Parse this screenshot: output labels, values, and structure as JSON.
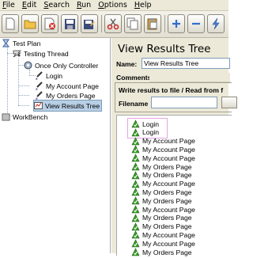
{
  "menu": [
    {
      "label": "File"
    },
    {
      "label": "Edit"
    },
    {
      "label": "Search"
    },
    {
      "label": "Run"
    },
    {
      "label": "Options"
    },
    {
      "label": "Help"
    }
  ],
  "toolbar": {
    "buttons": [
      "new-icon",
      "open-icon",
      "close-icon",
      "save-icon",
      "save-as-icon",
      "cut-icon",
      "copy-icon",
      "paste-icon",
      "expand-icon",
      "collapse-icon",
      "toggle-icon"
    ]
  },
  "tree": {
    "nodes": [
      {
        "label": "Test Plan",
        "icon": "test-plan-icon"
      },
      {
        "label": "Testing Thread",
        "icon": "thread-group-icon"
      },
      {
        "label": "Once Only Controller",
        "icon": "controller-icon"
      },
      {
        "label": "Login",
        "icon": "sampler-icon"
      },
      {
        "label": "My Account Page",
        "icon": "sampler-icon"
      },
      {
        "label": "My Orders Page",
        "icon": "sampler-icon"
      },
      {
        "label": "View Results Tree",
        "icon": "listener-icon"
      },
      {
        "label": "WorkBench",
        "icon": "workbench-icon"
      }
    ]
  },
  "panel": {
    "title": "View Results Tree",
    "name_label": "Name:",
    "name_value": "View Results Tree",
    "comments_label": "Comments:",
    "file_title": "Write results to file / Read from f",
    "filename_label": "Filename"
  },
  "results": [
    "Login",
    "Login",
    "My Account Page",
    "My Account Page",
    "My Account Page",
    "My Orders Page",
    "My Orders Page",
    "My Account Page",
    "My Orders Page",
    "My Orders Page",
    "My Account Page",
    "My Orders Page",
    "My Orders Page",
    "My Account Page",
    "My Account Page",
    "My Orders Page"
  ],
  "colors": {
    "success": "#3a9d2a",
    "selection": "#b8cfe5",
    "highlight": "#e2a6e0"
  }
}
